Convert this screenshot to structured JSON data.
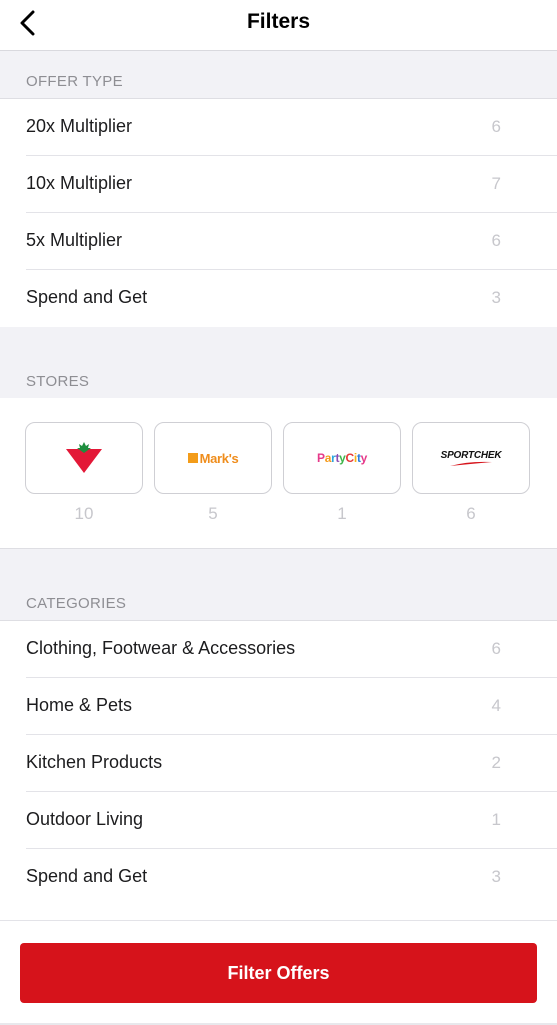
{
  "nav": {
    "title": "Filters",
    "back_icon": "chevron-left-icon"
  },
  "offer_type": {
    "header": "OFFER TYPE",
    "items": [
      {
        "label": "20x Multiplier",
        "count": "6"
      },
      {
        "label": "10x Multiplier",
        "count": "7"
      },
      {
        "label": "5x Multiplier",
        "count": "6"
      },
      {
        "label": "Spend and Get",
        "count": "3"
      }
    ]
  },
  "stores": {
    "header": "STORES",
    "items": [
      {
        "logo": "canadian-tire-logo",
        "count": "10"
      },
      {
        "logo": "marks-logo",
        "logo_text": "Mark's",
        "count": "5"
      },
      {
        "logo": "party-city-logo",
        "logo_text": "Party City",
        "count": "1"
      },
      {
        "logo": "sportchek-logo",
        "logo_text": "SPORTCHEK",
        "count": "6"
      }
    ]
  },
  "categories": {
    "header": "CATEGORIES",
    "items": [
      {
        "label": "Clothing, Footwear & Accessories",
        "count": "6"
      },
      {
        "label": "Home & Pets",
        "count": "4"
      },
      {
        "label": "Kitchen Products",
        "count": "2"
      },
      {
        "label": "Outdoor Living",
        "count": "1"
      },
      {
        "label": "Spend and Get",
        "count": "3"
      }
    ]
  },
  "footer": {
    "button_label": "Filter Offers"
  },
  "colors": {
    "accent": "#d6131b",
    "section_bg": "#f2f2f6",
    "muted_text": "#8e8e93",
    "count_text": "#c7c7cc"
  }
}
